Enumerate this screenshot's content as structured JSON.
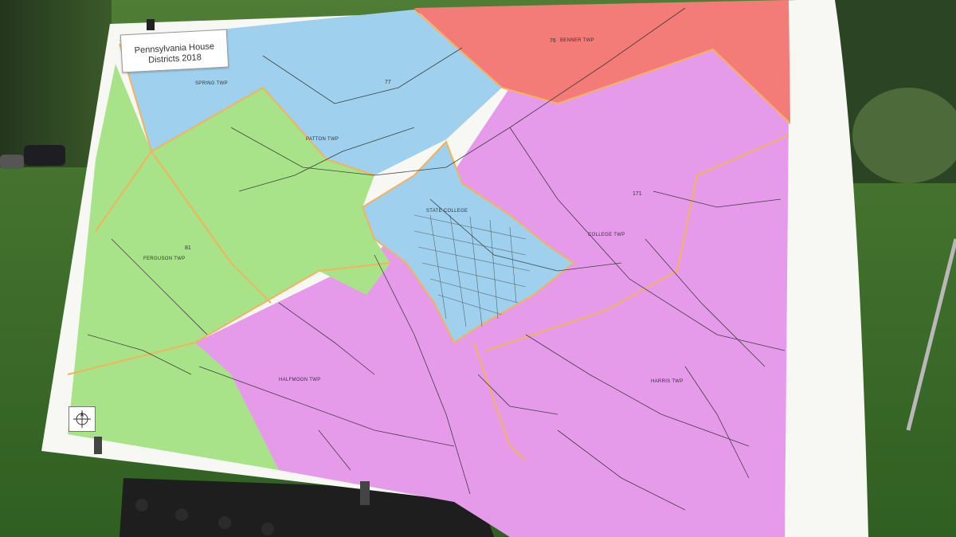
{
  "map": {
    "title_line1": "Pennsylvania House",
    "title_line2": "Districts 2018",
    "district_labels": [
      "76",
      "77",
      "171",
      "81"
    ],
    "township_labels": [
      "BENNER TWP",
      "SPRING TWP",
      "FERGUSON TWP",
      "STATE COLLEGE",
      "COLLEGE TWP",
      "PATTON TWP",
      "HALFMOON TWP",
      "HARRIS TWP"
    ],
    "colors": {
      "district_76": "#f47c78",
      "district_77": "#9fd0ee",
      "district_171": "#e59be9",
      "district_81": "#a8e38a",
      "boundary": "#f2b35c",
      "roads": "#2a2a2a",
      "grass": "#3f7a2f"
    },
    "compass_icon": "compass-rose-icon"
  }
}
